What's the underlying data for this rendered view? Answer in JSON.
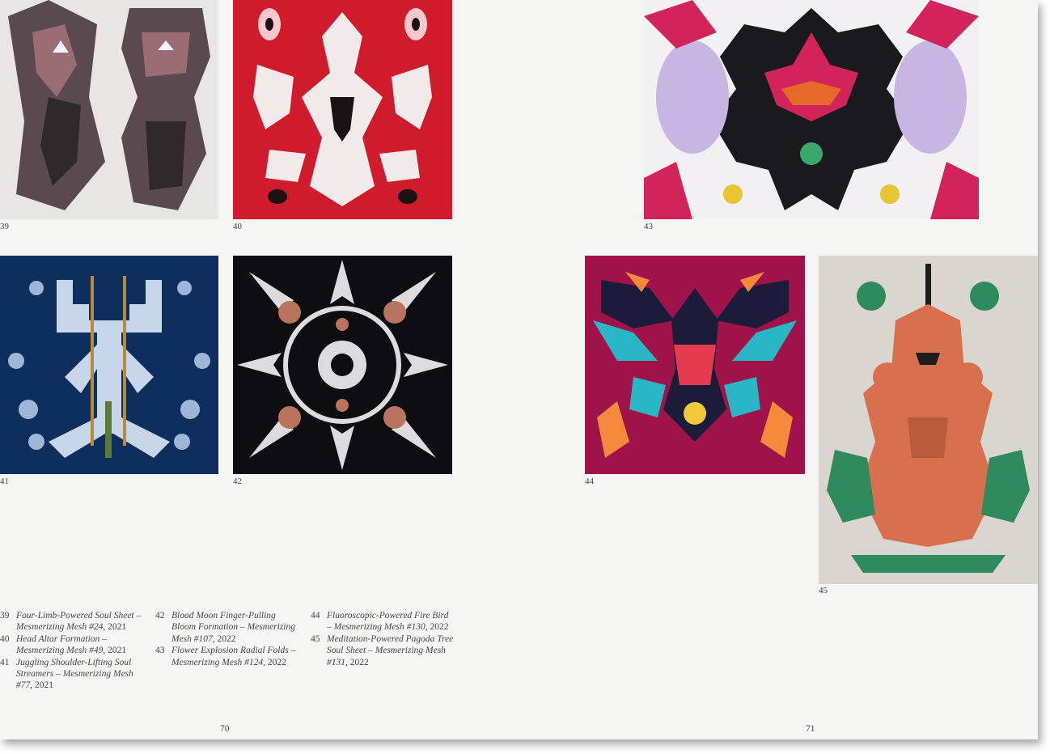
{
  "plates": [
    {
      "id": "39",
      "number": "39",
      "palette": {
        "bg": "#e8e6e4",
        "a": "#5a4a4f",
        "b": "#9a6c74",
        "c": "#2e2a2c"
      }
    },
    {
      "id": "40",
      "number": "40",
      "palette": {
        "bg": "#cf1b2c",
        "a": "#f2eaea",
        "b": "#1a1214",
        "c": "#f6c8cd"
      }
    },
    {
      "id": "41",
      "number": "41",
      "palette": {
        "bg": "#0e2f5e",
        "a": "#c8d6ea",
        "b": "#9fb6d6",
        "c": "#b98a3a"
      }
    },
    {
      "id": "42",
      "number": "42",
      "palette": {
        "bg": "#0e0d12",
        "a": "#dcdcde",
        "b": "#b9745e",
        "c": "#8f8f94"
      }
    },
    {
      "id": "43",
      "number": "43",
      "palette": {
        "bg": "#f2f0f2",
        "a": "#d2245a",
        "b": "#1a1a1e",
        "c": "#c8b6e2"
      }
    },
    {
      "id": "44",
      "number": "44",
      "palette": {
        "bg": "#a0124a",
        "a": "#2ab7c5",
        "b": "#f3893a",
        "c": "#1b1c3a"
      }
    },
    {
      "id": "45",
      "number": "45",
      "palette": {
        "bg": "#d9d6cf",
        "a": "#d8704f",
        "b": "#2f8a5c",
        "c": "#1d1d1d"
      }
    }
  ],
  "captions": {
    "col1": [
      {
        "num": "39",
        "title": "Four-Limb-Powered Soul Sheet – Mesmerizing Mesh #24",
        "year": ", 2021"
      },
      {
        "num": "40",
        "title": "Head Altar Formation – Mesmerizing Mesh #49",
        "year": ", 2021"
      },
      {
        "num": "41",
        "title": "Juggling Shoulder-Lifting Soul Streamers – Mesmerizing Mesh #77",
        "year": ", 2021"
      }
    ],
    "col2": [
      {
        "num": "42",
        "title": "Blood Moon Finger-Pulling Bloom Formation – Mesmerizing Mesh #107",
        "year": ", 2022"
      },
      {
        "num": "43",
        "title": "Flower Explosion Radial Folds – Mesmerizing Mesh #124",
        "year": ", 2022"
      }
    ],
    "col3": [
      {
        "num": "44",
        "title": "Fluoroscopic-Powered Fire Bird – Mesmerizing Mesh #130",
        "year": ", 2022"
      },
      {
        "num": "45",
        "title": "Meditation-Powered Pagoda Tree Soul Sheet – Mesmerizing Mesh #131",
        "year": ", 2022"
      }
    ]
  },
  "folios": {
    "left": "70",
    "right": "71"
  }
}
